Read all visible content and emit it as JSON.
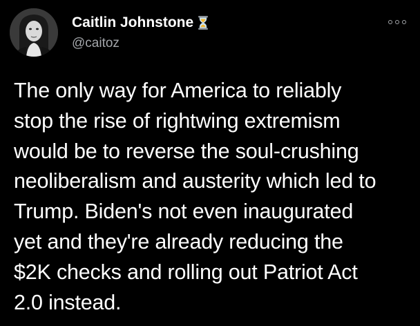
{
  "author": {
    "display_name": "Caitlin Johnstone",
    "handle": "@caitoz",
    "name_emoji_icon": "hourglass-icon",
    "avatar_icon": "profile-photo"
  },
  "menu": {
    "icon": "more-options-icon"
  },
  "tweet": {
    "lines": [
      "The only way for America to reliably",
      "stop the rise of rightwing extremism",
      "would be to reverse the soul-crushing",
      "neoliberalism and austerity which led to",
      "Trump. Biden's not even inaugurated",
      "yet and they're already reducing the",
      "$2K checks and rolling out Patriot Act",
      "2.0 instead."
    ]
  },
  "colors": {
    "background": "#000000",
    "text": "#ffffff",
    "secondary_text": "#a4a7ab",
    "hourglass_sand": "#f5b731"
  }
}
